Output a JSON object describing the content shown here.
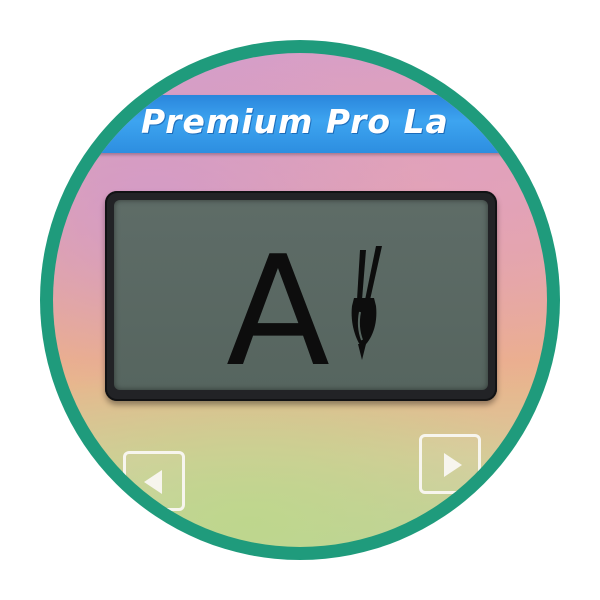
{
  "device": {
    "brand_banner": "Premium Pro La",
    "display": {
      "character": "A",
      "icon": "paintbrush-icon"
    }
  },
  "controls": {
    "prev_icon": "arrow-left-icon",
    "next_icon": "arrow-right-icon"
  },
  "colors": {
    "frame": "#1f9b7c",
    "banner": "#3da4f0",
    "lcd_background": "#5e6c67",
    "lcd_ink": "#0d0d0d"
  }
}
